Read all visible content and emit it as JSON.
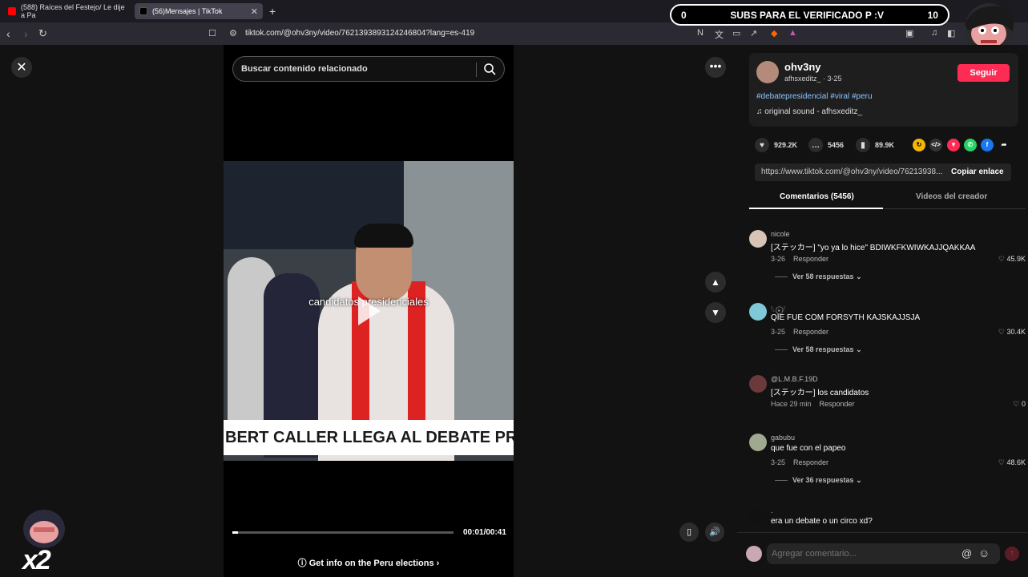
{
  "browser": {
    "tabs": [
      {
        "label": "(588) Raíces del Festejo/ Le dije a Pa"
      },
      {
        "label": "(56)Mensajes | TikTok"
      }
    ],
    "new_tab": "+",
    "url": "tiktok.com/@ohv3ny/video/7621393893124246804?lang=es-419"
  },
  "overlay": {
    "sub_left": "0",
    "sub_title": "SUBS PARA EL VERIFICADO P :V",
    "sub_right": "10",
    "multiplier": "x2"
  },
  "video": {
    "search_placeholder": "Buscar contenido relacionado",
    "caption": "candidatos presidenciales",
    "lower_third": "BERT CALLER LLEGA AL DEBATE PR",
    "time": "00:01/00:41",
    "progress": 0.024,
    "info_text": "Get info on the Peru elections"
  },
  "post": {
    "username": "ohv3ny",
    "handle": "afhsxeditz_ · 3-25",
    "follow_label": "Seguir",
    "tags": "#debatepresidencial #viral #peru",
    "sound": "original sound - afhsxeditz_",
    "likes": "929.2K",
    "comments": "5456",
    "saves": "89.9K",
    "link": "https://www.tiktok.com/@ohv3ny/video/76213938...",
    "copy_label": "Copiar enlace"
  },
  "tabs": {
    "comments": "Comentarios (5456)",
    "creator": "Videos del creador"
  },
  "comments": [
    {
      "name": "nicole",
      "text": "[ステッカー] \"yo ya lo hice\" BDIWKFKWIWKAJJQAKKAA",
      "date": "3-26",
      "reply": "Responder",
      "likes": "45.9K",
      "more": "Ver 58 respuestas",
      "avatar_color": "#d8c4b4"
    },
    {
      "name": "𓆩 ⍣⃝𓆪",
      "text": "QIE FUE COM FORSYTH KAJSKAJJSJA",
      "date": "3-25",
      "reply": "Responder",
      "likes": "30.4K",
      "more": "Ver 58 respuestas",
      "avatar_color": "#7fc8d8"
    },
    {
      "name": "@L.M.B.F.19D",
      "text": "[ステッカー] los candidatos",
      "date": "Hace 29 min",
      "reply": "Responder",
      "likes": "0",
      "more": "",
      "avatar_color": "#6a3a3a"
    },
    {
      "name": "gabubu",
      "text": "que fue con el papeo",
      "date": "3-25",
      "reply": "Responder",
      "likes": "48.6K",
      "more": "Ver 36 respuestas",
      "avatar_color": "#a0a890"
    },
    {
      "name": ".",
      "text": "era un debate o un circo xd?",
      "date": "",
      "reply": "",
      "likes": "",
      "more": "",
      "avatar_color": "#111111"
    }
  ],
  "input": {
    "placeholder": "Agregar comentario..."
  },
  "colors": {
    "accent": "#fe2c55",
    "hashtag": "#8ec5ff",
    "background": "#121212"
  }
}
